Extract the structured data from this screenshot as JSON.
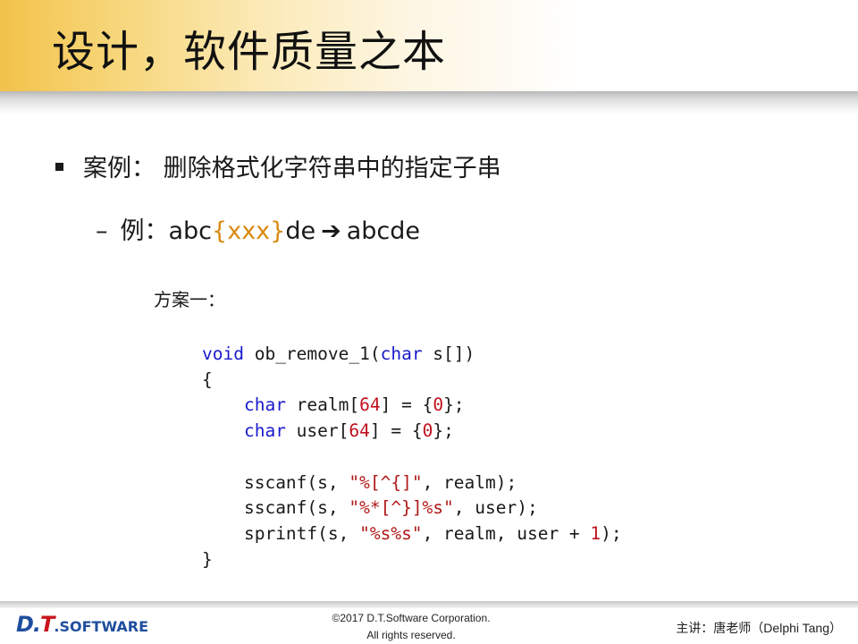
{
  "title": "设计，软件质量之本",
  "bullet": {
    "text": "案例： 删除格式化字符串中的指定子串"
  },
  "example": {
    "dash": "–",
    "label": "例：",
    "pre": "abc",
    "highlight": "{xxx}",
    "post": "de",
    "arrow": "➔",
    "result": "abcde"
  },
  "plan_label": "方案一：",
  "code": {
    "l1_kw": "void",
    "l1_mid": " ob_remove_1(",
    "l1_kw2": "char",
    "l1_end": " s[])",
    "l2": "{",
    "l3_kw": "char",
    "l3_a": " realm[",
    "l3_num": "64",
    "l3_b": "] = {",
    "l3_num2": "0",
    "l3_c": "};",
    "l4_kw": "char",
    "l4_a": " user[",
    "l4_num": "64",
    "l4_b": "] = {",
    "l4_num2": "0",
    "l4_c": "};",
    "l6_a": "sscanf(s, ",
    "l6_str": "\"%[^{]\"",
    "l6_b": ", realm);",
    "l7_a": "sscanf(s, ",
    "l7_str": "\"%*[^}]%s\"",
    "l7_b": ", user);",
    "l8_a": "sprintf(s, ",
    "l8_str": "\"%s%s\"",
    "l8_b": ", realm, user + ",
    "l8_num": "1",
    "l8_c": ");",
    "l9": "}"
  },
  "footer": {
    "logo_dt": "D.",
    "logo_t": "T",
    "logo_soft": ".SOFTWARE",
    "copyright_line1": "©2017 D.T.Software Corporation.",
    "copyright_line2": "All rights reserved.",
    "lecturer": "主讲：唐老师（Delphi Tang）"
  },
  "colors": {
    "title_gradient_start": "#f2c24a",
    "highlight": "#d98a12",
    "keyword": "#1a1acc",
    "number": "#c0121e",
    "string": "#b01818",
    "logo_blue": "#1f4e9e",
    "logo_red": "#c8151d"
  }
}
